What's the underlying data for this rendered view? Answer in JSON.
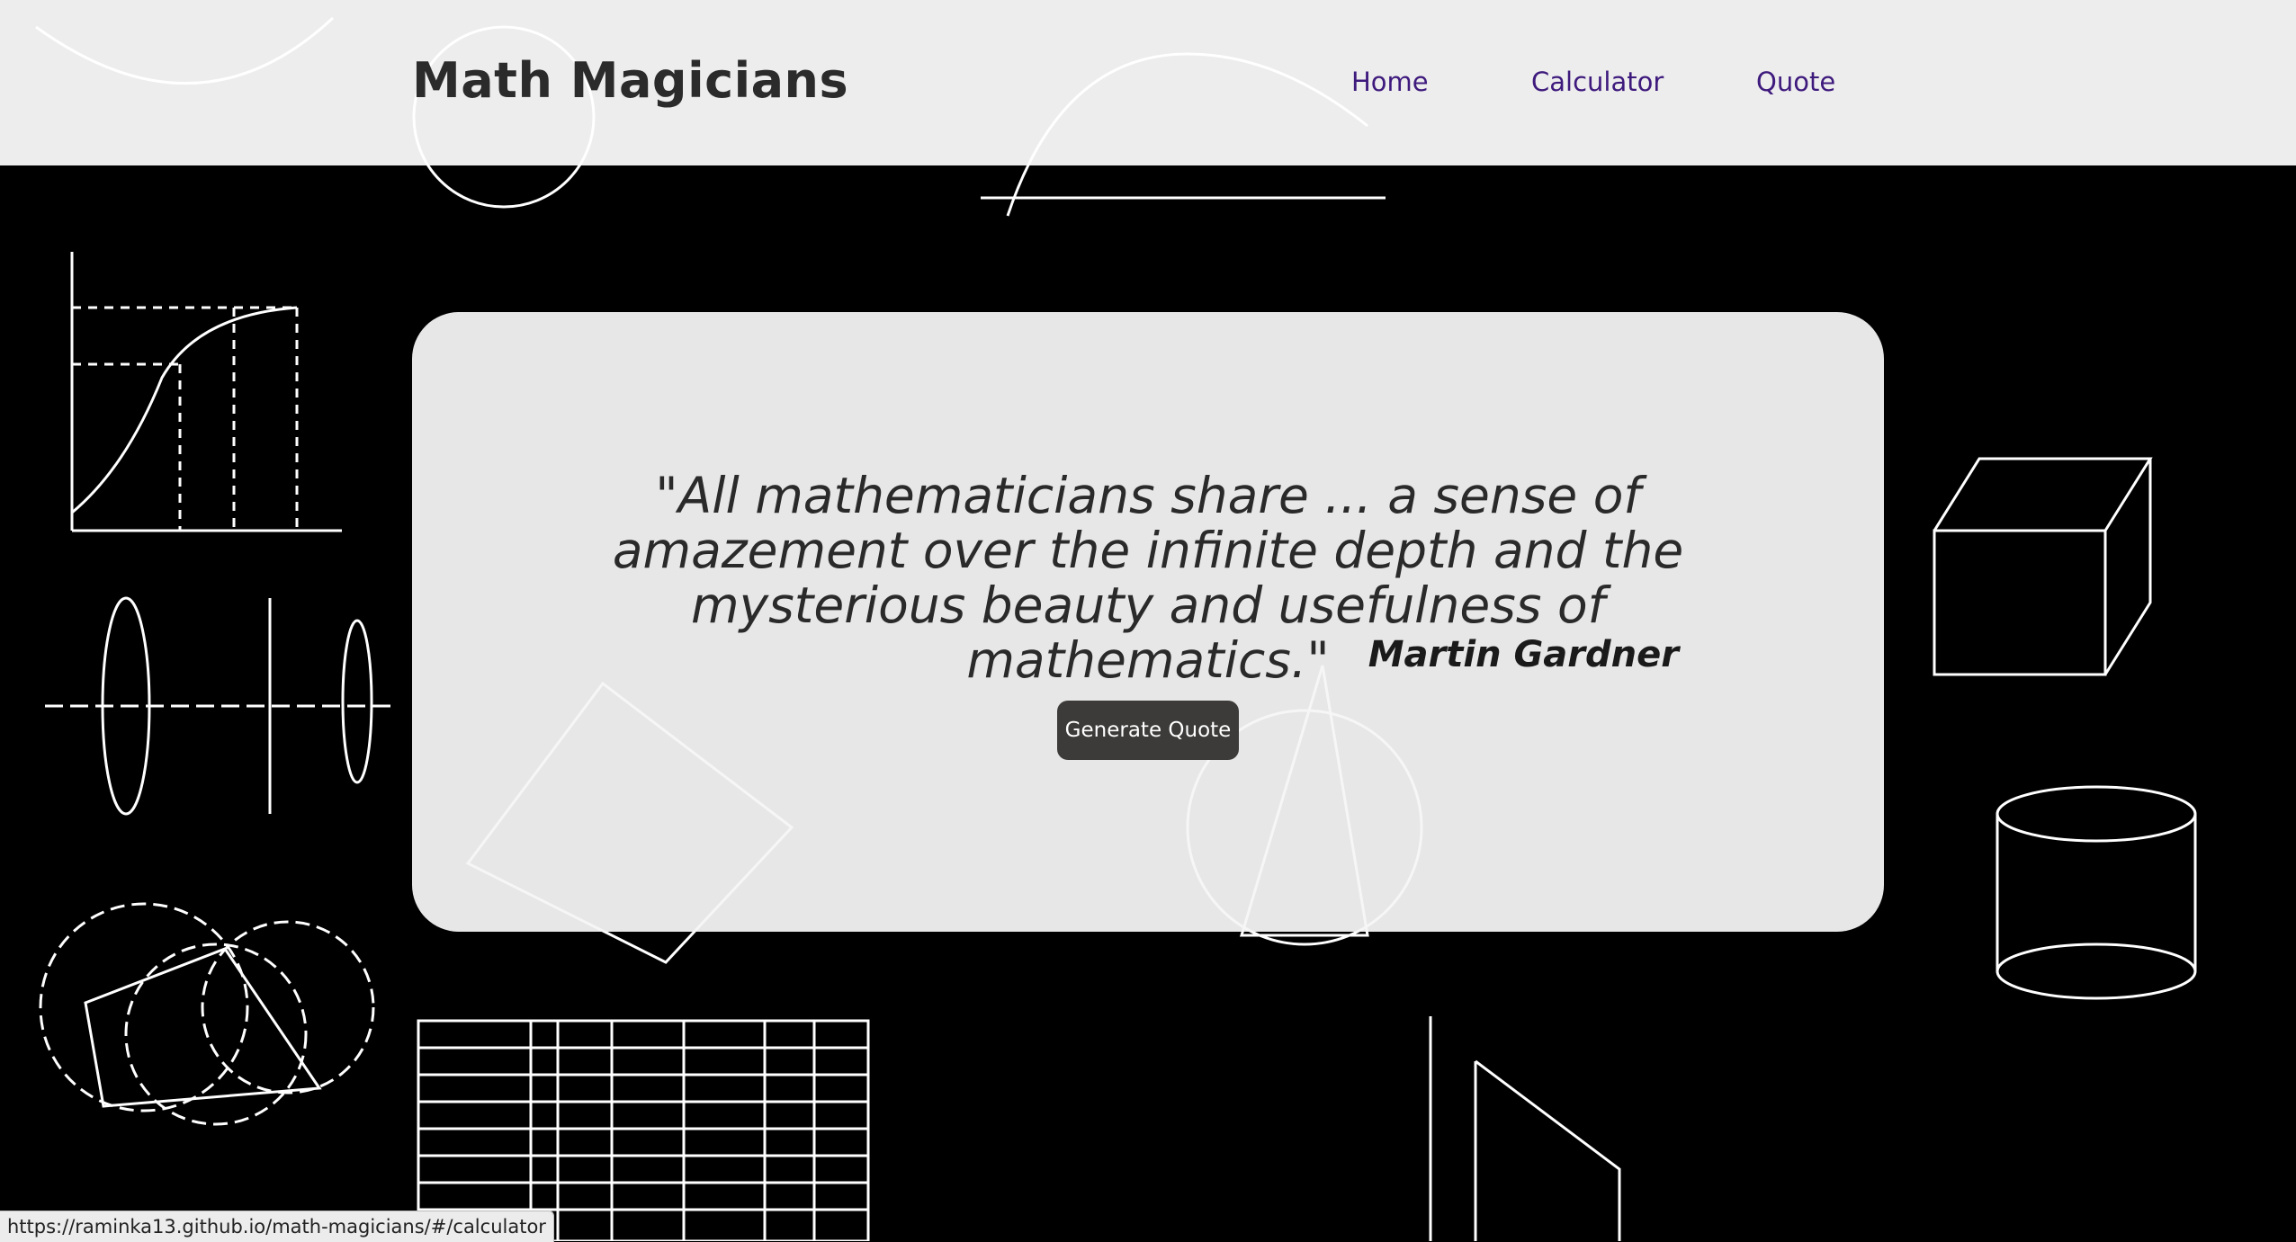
{
  "header": {
    "logo": "Math Magicians",
    "nav": [
      {
        "label": "Home"
      },
      {
        "label": "Calculator"
      },
      {
        "label": "Quote"
      }
    ]
  },
  "quote_card": {
    "quote": "\"All mathematicians share ... a sense of amazement over the infinite depth and the mysterious beauty and usefulness of mathematics.\"",
    "author": "Martin Gardner",
    "button_label": "Generate Quote"
  },
  "status_bar": {
    "url": "https://raminka13.github.io/math-magicians/#/calculator"
  },
  "colors": {
    "nav_link": "#3e1a7d",
    "button_bg": "#3d3b39",
    "background": "#000000",
    "card_bg": "#f5f5f5"
  }
}
